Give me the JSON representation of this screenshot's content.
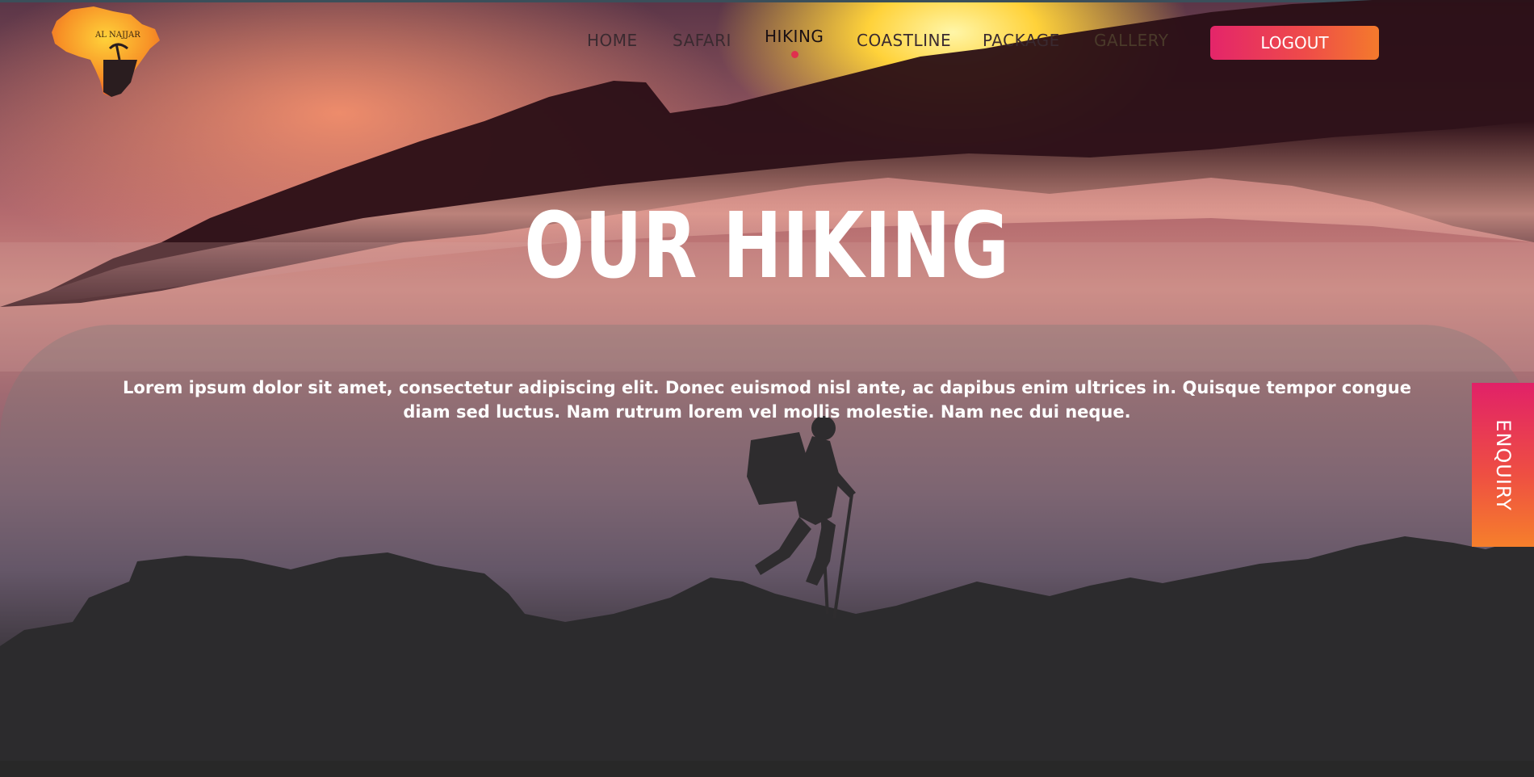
{
  "nav": {
    "items": [
      {
        "label": "HOME"
      },
      {
        "label": "SAFARI"
      },
      {
        "label": "HIKING"
      },
      {
        "label": "COASTLINE"
      },
      {
        "label": "PACKAGE"
      },
      {
        "label": "GALLERY"
      }
    ],
    "active": "HIKING",
    "logout_label": "LOGOUT"
  },
  "logo": {
    "text": "AL NAJJAR",
    "icon": "africa-map-logo-icon"
  },
  "hero": {
    "title": "OUR HIKING",
    "description": "Lorem ipsum dolor sit amet, consectetur adipiscing elit. Donec euismod nisl ante, ac dapibus enim ultrices in. Quisque tempor congue diam sed luctus. Nam rutrum lorem vel mollis molestie. Nam nec dui neque."
  },
  "enquiry": {
    "label": "ENQUIRY"
  },
  "colors": {
    "accent_pink": "#e4256a",
    "accent_orange": "#f47a2c",
    "active_dot": "#e0304e"
  }
}
